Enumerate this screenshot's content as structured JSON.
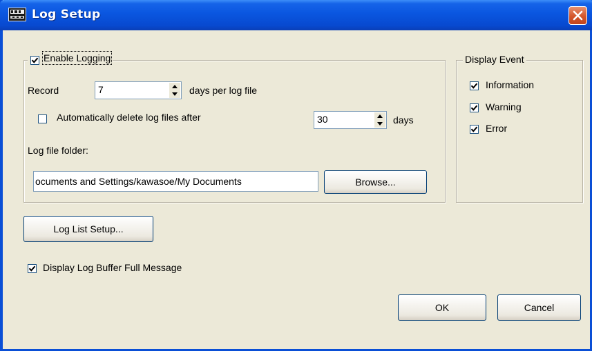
{
  "window": {
    "title": "Log Setup",
    "app_icon": "dme-app-icon",
    "close_icon": "close-icon"
  },
  "logging": {
    "enable_label": "Enable Logging",
    "enable_checked": true,
    "record_label": "Record",
    "record_value": "7",
    "record_suffix": "days per log file",
    "auto_delete_label": "Automatically delete log files after",
    "auto_delete_checked": false,
    "auto_delete_value": "30",
    "auto_delete_suffix": "days",
    "folder_label": "Log file folder:",
    "folder_value": "ocuments and Settings/kawasoe/My Documents",
    "browse_label": "Browse..."
  },
  "display_event": {
    "legend": "Display Event",
    "items": [
      {
        "label": "Information",
        "checked": true
      },
      {
        "label": "Warning",
        "checked": true
      },
      {
        "label": "Error",
        "checked": true
      }
    ]
  },
  "log_list_setup_label": "Log List Setup...",
  "buffer_message": {
    "label": "Display Log Buffer Full Message",
    "checked": true
  },
  "ok_label": "OK",
  "cancel_label": "Cancel"
}
